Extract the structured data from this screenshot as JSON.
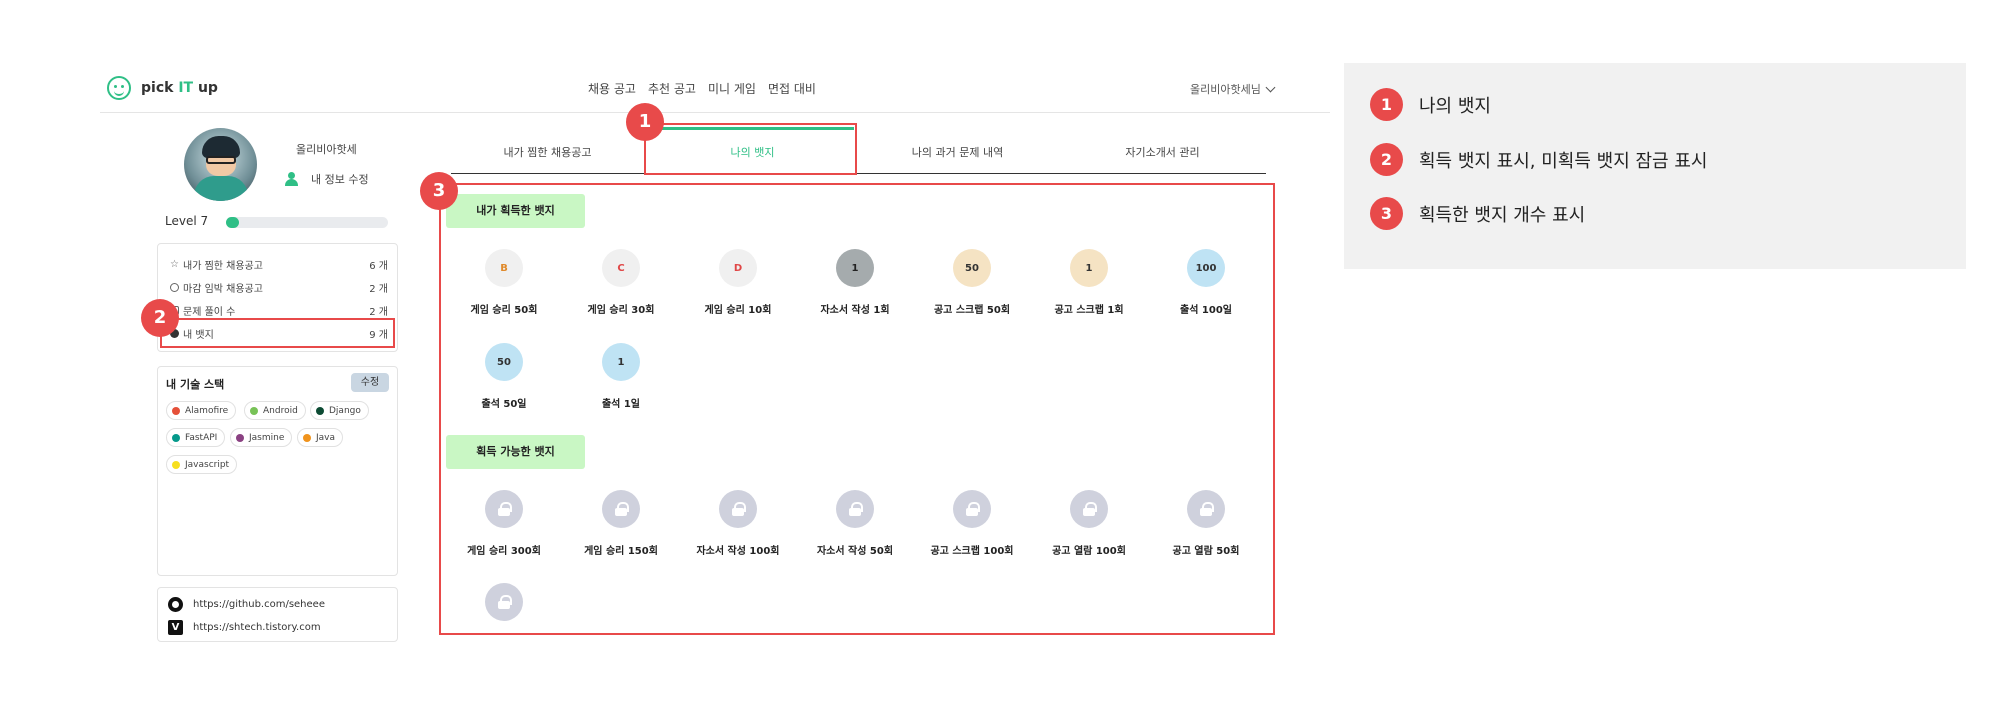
{
  "header": {
    "logo": {
      "pre": "pick ",
      "highlight": "IT",
      "post": " up"
    },
    "nav": [
      "채용 공고",
      "추천 공고",
      "미니 게임",
      "면접 대비"
    ],
    "user_menu": "올리비아핫세님"
  },
  "profile": {
    "nickname": "올리비아핫세",
    "edit_label": "내 정보 수정",
    "level_label": "Level 7",
    "level_progress": 0.08
  },
  "stats": [
    {
      "label": "내가 찜한 채용공고",
      "value": "6 개"
    },
    {
      "label": "마감 임박 채용공고",
      "value": "2 개"
    },
    {
      "label": "문제 풀이 수",
      "value": "2 개"
    },
    {
      "label": "내 뱃지",
      "value": "9 개"
    }
  ],
  "skills": {
    "title": "내 기술 스택",
    "edit_label": "수정",
    "items": [
      {
        "name": "Alamofire",
        "color": "#e55039"
      },
      {
        "name": "Android",
        "color": "#78c257"
      },
      {
        "name": "Django",
        "color": "#0c4b33"
      },
      {
        "name": "FastAPI",
        "color": "#05998b"
      },
      {
        "name": "Jasmine",
        "color": "#8a4182"
      },
      {
        "name": "Java",
        "color": "#f0931c"
      },
      {
        "name": "Javascript",
        "color": "#f7df1e"
      }
    ]
  },
  "links": [
    "https://github.com/seheee",
    "https://shtech.tistory.com"
  ],
  "tabs": [
    "내가 찜한 채용공고",
    "나의 뱃지",
    "나의 과거 문제 내역",
    "자기소개서 관리"
  ],
  "active_tab": 1,
  "badges": {
    "acquired_title": "내가 획득한 뱃지",
    "acquired": [
      {
        "name": "게임 승리 50회",
        "symbol": "B",
        "color": "#f0f0f0",
        "fg": "#e08a2b"
      },
      {
        "name": "게임 승리 30회",
        "symbol": "C",
        "color": "#f0f0f0",
        "fg": "#e04646"
      },
      {
        "name": "게임 승리 10회",
        "symbol": "D",
        "color": "#f0f0f0",
        "fg": "#e04646"
      },
      {
        "name": "자소서 작성 1회",
        "symbol": "1",
        "color": "#a5abad",
        "fg": "#222"
      },
      {
        "name": "공고 스크랩 50회",
        "symbol": "50",
        "color": "#f5e3c3",
        "fg": "#333"
      },
      {
        "name": "공고 스크랩 1회",
        "symbol": "1",
        "color": "#f5e3c3",
        "fg": "#333"
      },
      {
        "name": "출석 100일",
        "symbol": "100",
        "color": "#bfe3f4",
        "fg": "#333"
      },
      {
        "name": "출석 50일",
        "symbol": "50",
        "color": "#bfe3f4",
        "fg": "#333"
      },
      {
        "name": "출석 1일",
        "symbol": "1",
        "color": "#bfe3f4",
        "fg": "#333"
      }
    ],
    "available_title": "획득 가능한 뱃지",
    "available": [
      {
        "name": "게임 승리 300회"
      },
      {
        "name": "게임 승리 150회"
      },
      {
        "name": "자소서 작성 100회"
      },
      {
        "name": "자소서 작성 50회"
      },
      {
        "name": "공고 스크랩 100회"
      },
      {
        "name": "공고 열람 100회"
      },
      {
        "name": "공고 열람 50회"
      },
      {
        "name": ""
      }
    ]
  },
  "markers": [
    "1",
    "2",
    "3"
  ],
  "legend": [
    {
      "num": "1",
      "text": "나의 뱃지"
    },
    {
      "num": "2",
      "text": "획득 뱃지 표시, 미획득 뱃지 잠금 표시"
    },
    {
      "num": "3",
      "text": "획득한 뱃지 개수 표시"
    }
  ]
}
